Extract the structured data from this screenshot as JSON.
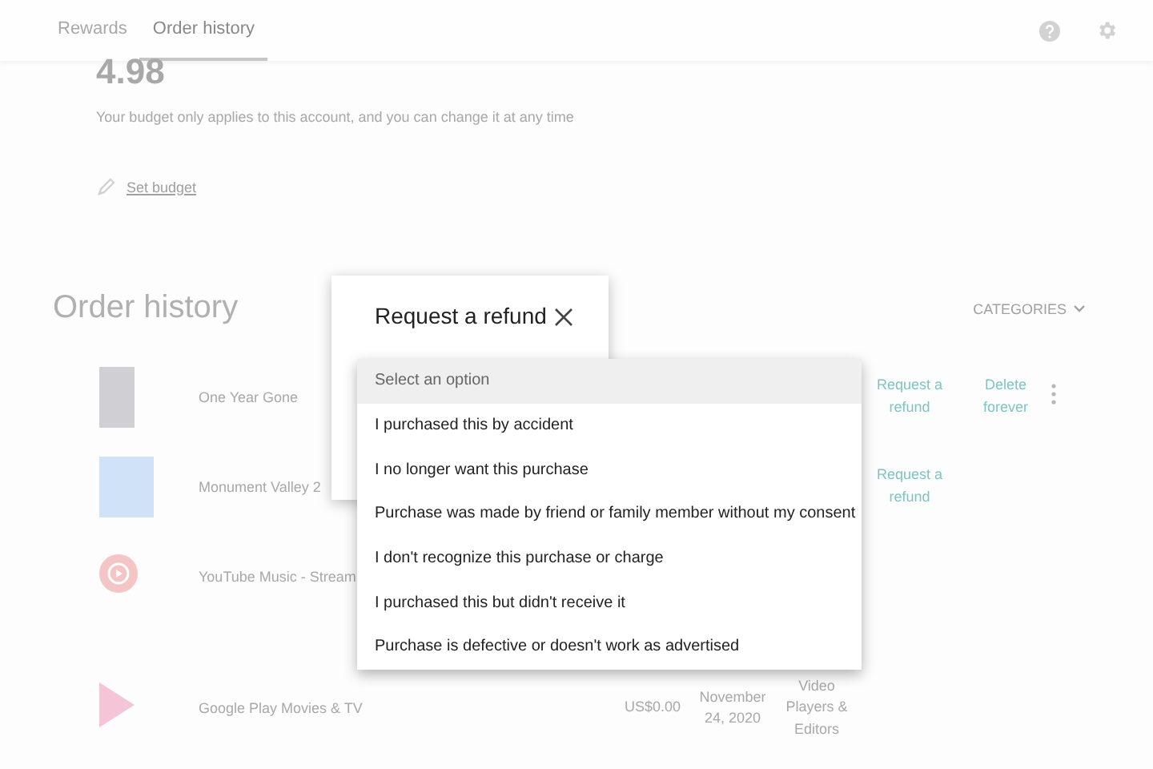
{
  "tabs": [
    {
      "label": "Rewards",
      "selected": false
    },
    {
      "label": "Order history",
      "selected": true
    }
  ],
  "budget": {
    "amount": "4.98",
    "note": "Your budget only applies to this account, and you can change it at any time",
    "link": "Set budget"
  },
  "order_history": {
    "title": "Order history",
    "filter": "CATEGORIES",
    "rows": [
      {
        "kind": "poster",
        "name": "One Year Gone",
        "actions": [
          "Request a refund",
          "Delete forever"
        ],
        "more": true
      },
      {
        "kind": "game",
        "name": "Monument Valley 2",
        "actions": [
          "Request a refund"
        ],
        "more": false
      },
      {
        "kind": "music",
        "name": "YouTube Music - Stream",
        "more": false
      },
      {
        "kind": "movies",
        "name": "Google Play Movies & TV",
        "price": "US$0.00",
        "date": "November 24, 2020",
        "category": "Video Players & Editors",
        "more": false
      }
    ]
  },
  "dialog": {
    "title": "Request a refund"
  },
  "dropdown": {
    "options": [
      {
        "label": "Select an option",
        "selected": true
      },
      {
        "label": "I purchased this by accident",
        "selected": false
      },
      {
        "label": "I no longer want this purchase",
        "selected": false
      },
      {
        "label": "Purchase was made by friend or family member without my consent",
        "selected": false
      },
      {
        "label": "I don't recognize this purchase or charge",
        "selected": false
      },
      {
        "label": "I purchased this but didn't receive it",
        "selected": false
      },
      {
        "label": "Purchase is defective or doesn't work as advertised",
        "selected": false
      }
    ]
  }
}
